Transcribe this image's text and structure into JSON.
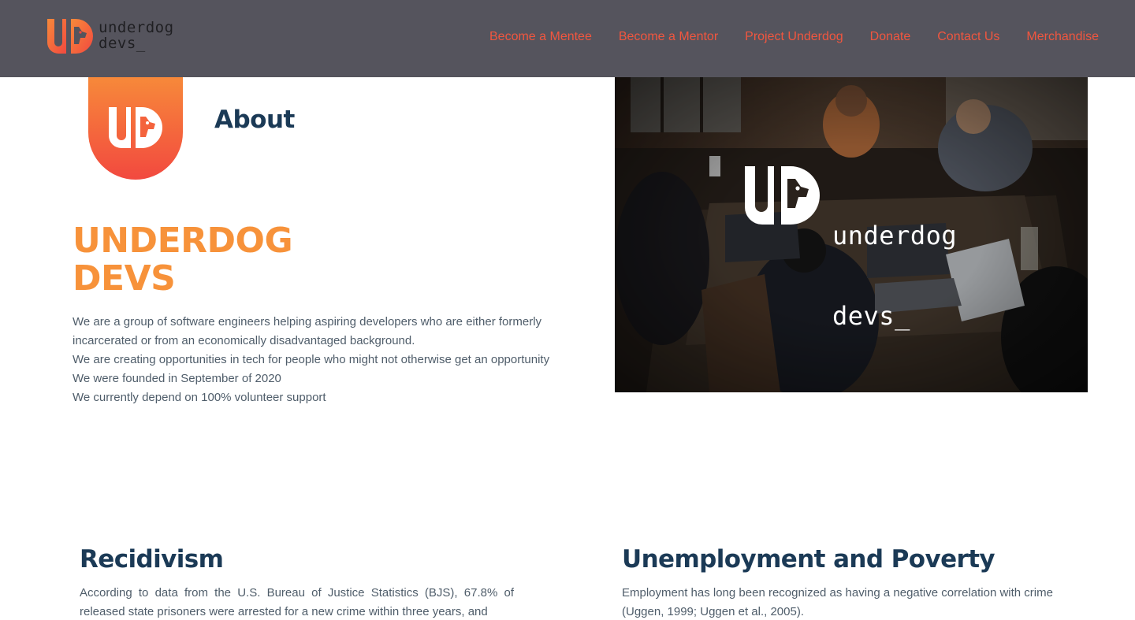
{
  "brand": {
    "line1": "underdog",
    "line2": "devs_",
    "colors": {
      "orange": "#f7923a",
      "red": "#f2493f",
      "navy": "#1b3a56",
      "header_bg": "#55545d"
    }
  },
  "nav": {
    "items": [
      "Become a Mentee",
      "Become a Mentor",
      "Project Underdog",
      "Donate",
      "Contact Us",
      "Merchandise"
    ]
  },
  "about": {
    "title": "About",
    "name_line1": "UNDERDOG",
    "name_line2": "DEVS",
    "lines": [
      "We are a group of software engineers helping aspiring developers who are either formerly",
      "incarcerated or from an economically disadvantaged background.",
      "We are creating opportunities in tech for people who might not otherwise get an opportunity",
      "We were founded in September of 2020",
      "We currently depend on 100% volunteer support"
    ]
  },
  "hero": {
    "logo_line1": "underdog",
    "logo_line2": "devs_"
  },
  "sections": {
    "recidivism": {
      "title": "Recidivism",
      "body": "According to data from the U.S. Bureau of Justice Statistics (BJS), 67.8% of released state prisoners were arrested for a new crime within three years, and"
    },
    "unemployment": {
      "title": "Unemployment and Poverty",
      "body": "Employment has long been recognized as having a negative correlation with crime (Uggen, 1999; Uggen et al., 2005)."
    }
  },
  "icons": {
    "logo": "underdog-ud-logo-icon"
  }
}
